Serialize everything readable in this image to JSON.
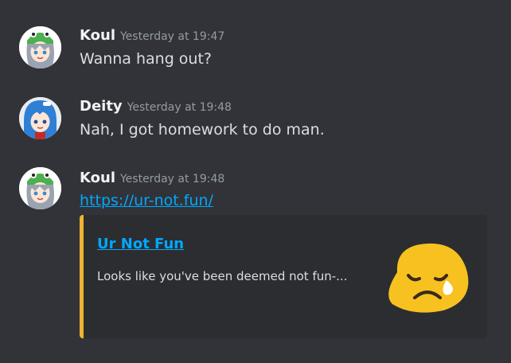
{
  "messages": [
    {
      "username": "Koul",
      "timestamp": "Yesterday at 19:47",
      "text": "Wanna hang out?",
      "avatar_icon": "frog-hat-anime-avatar"
    },
    {
      "username": "Deity",
      "timestamp": "Yesterday at 19:48",
      "text": "Nah, I got homework to do man.",
      "avatar_icon": "blue-hair-anime-avatar"
    },
    {
      "username": "Koul",
      "timestamp": "Yesterday at 19:48",
      "link": "https://ur-not.fun/",
      "avatar_icon": "frog-hat-anime-avatar",
      "embed": {
        "title": "Ur Not Fun",
        "description": "Looks like you've been deemed not fun-...",
        "thumbnail_icon": "sad-tear-face-icon",
        "accent_color": "#f0b232"
      }
    }
  ],
  "colors": {
    "background": "#313338",
    "embed_background": "#2b2d31",
    "link": "#00a8fc",
    "username": "#f2f3f5",
    "timestamp": "#949ba4",
    "text": "#dbdee1"
  }
}
